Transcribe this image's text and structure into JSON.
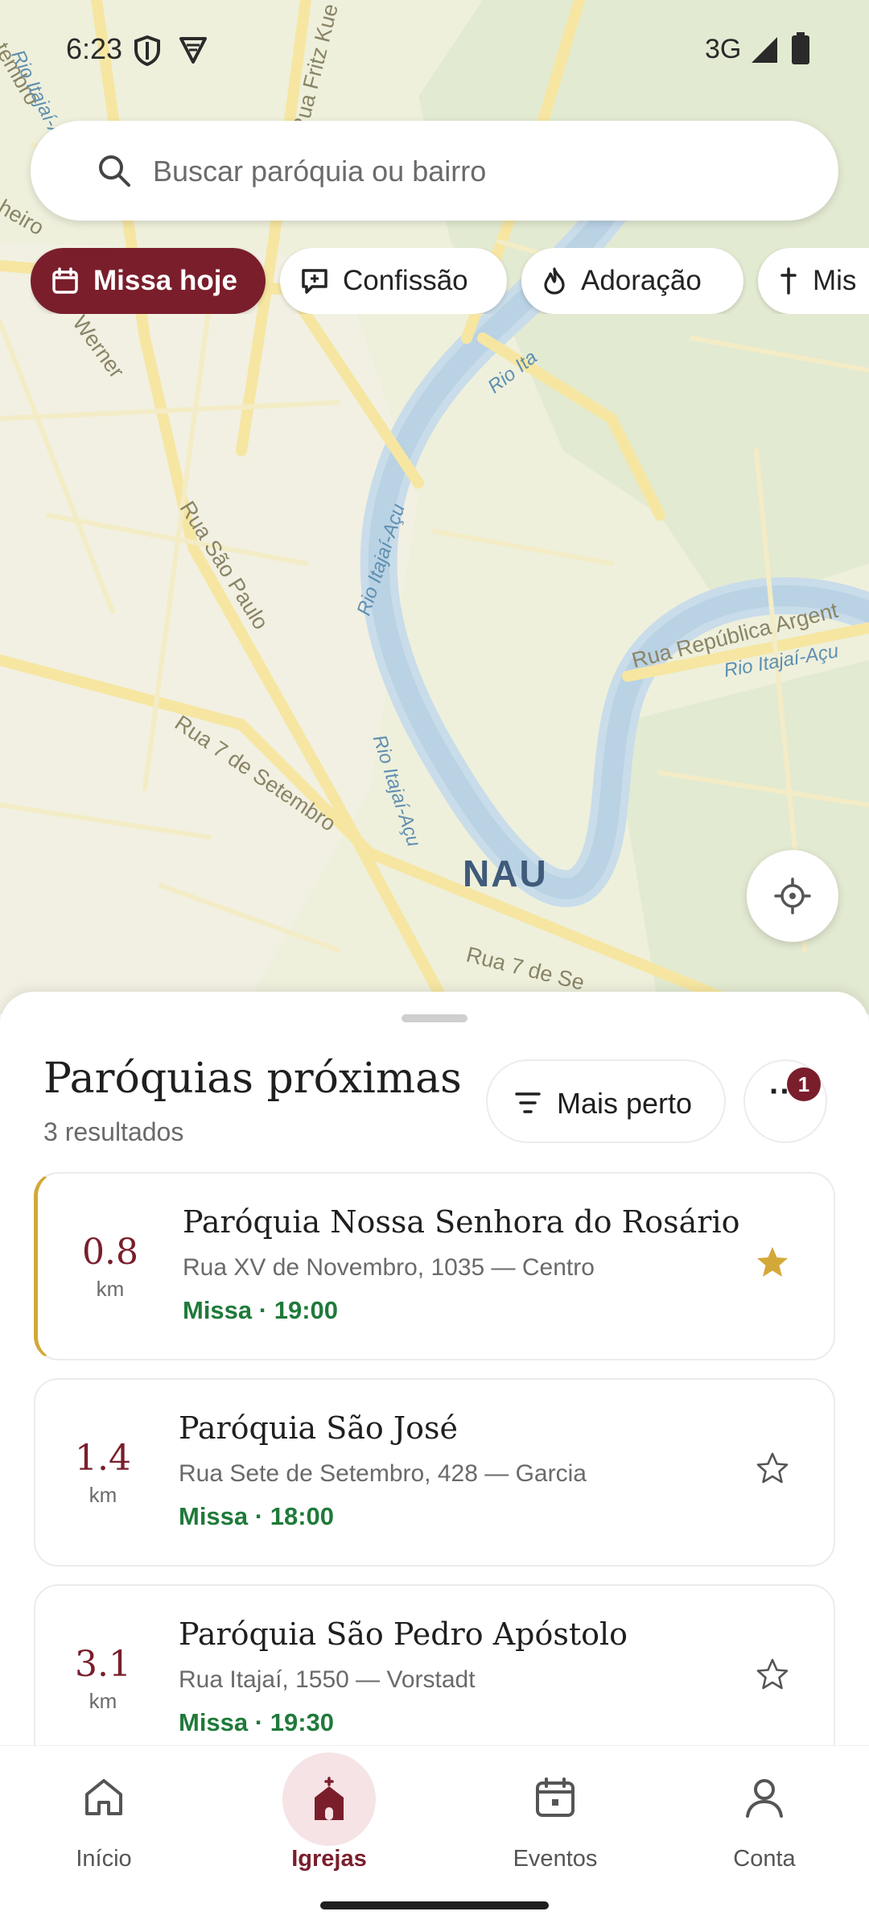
{
  "status_bar": {
    "time": "6:23",
    "network": "3G",
    "icons": [
      "shield-icon",
      "vpn-icon",
      "signal-icon",
      "battery-icon"
    ]
  },
  "search": {
    "placeholder": "Buscar paróquia ou bairro",
    "value": ""
  },
  "filters": [
    {
      "label": "Missa hoje",
      "icon": "calendar-icon",
      "active": true
    },
    {
      "label": "Confissão",
      "icon": "chat-icon",
      "active": false
    },
    {
      "label": "Adoração",
      "icon": "flame-icon",
      "active": false
    },
    {
      "label": "Mis",
      "icon": "cross-icon",
      "active": false
    }
  ],
  "map": {
    "city_label": "NAU",
    "street_labels": [
      "Rua São Paulo",
      "Rua 7 de Setembro",
      "Rua República Argent",
      "Rua 7 de Se",
      "Rua Fritz Kue",
      "heiro",
      "Werner",
      "tembro"
    ],
    "river_labels": [
      "Rio Itajaí-Açu",
      "Rio Itajaí-Açu",
      "Rio Itajaí-Açu",
      "Rio Ita",
      "Rio Itajaí-Açu"
    ]
  },
  "sheet": {
    "title": "Paróquias próximas",
    "count": "3 resultados",
    "sort_label": "Mais perto",
    "more_label": "···",
    "badge": "1"
  },
  "parishes": [
    {
      "distance": "0.8",
      "unit": "km",
      "name": "Paróquia Nossa Senhora do Rosário",
      "address": "Rua XV de Novembro, 1035 — Centro",
      "mass": "Missa · 19:00",
      "favorite": true
    },
    {
      "distance": "1.4",
      "unit": "km",
      "name": "Paróquia São José",
      "address": "Rua Sete de Setembro, 428 — Garcia",
      "mass": "Missa · 18:00",
      "favorite": false
    },
    {
      "distance": "3.1",
      "unit": "km",
      "name": "Paróquia São Pedro Apóstolo",
      "address": "Rua Itajaí, 1550 — Vorstadt",
      "mass": "Missa · 19:30",
      "favorite": false
    }
  ],
  "nav": [
    {
      "label": "Início",
      "icon": "home-icon",
      "active": false
    },
    {
      "label": "Igrejas",
      "icon": "church-icon",
      "active": true
    },
    {
      "label": "Eventos",
      "icon": "calendar-icon",
      "active": false
    },
    {
      "label": "Conta",
      "icon": "user-icon",
      "active": false
    }
  ],
  "colors": {
    "brand": "#7a1e2c",
    "favorite": "#d4a838",
    "mass_time": "#1f7a3a",
    "map_bg": "#eef0dc",
    "river": "#bfd7e8",
    "road": "#f7e9a6"
  }
}
